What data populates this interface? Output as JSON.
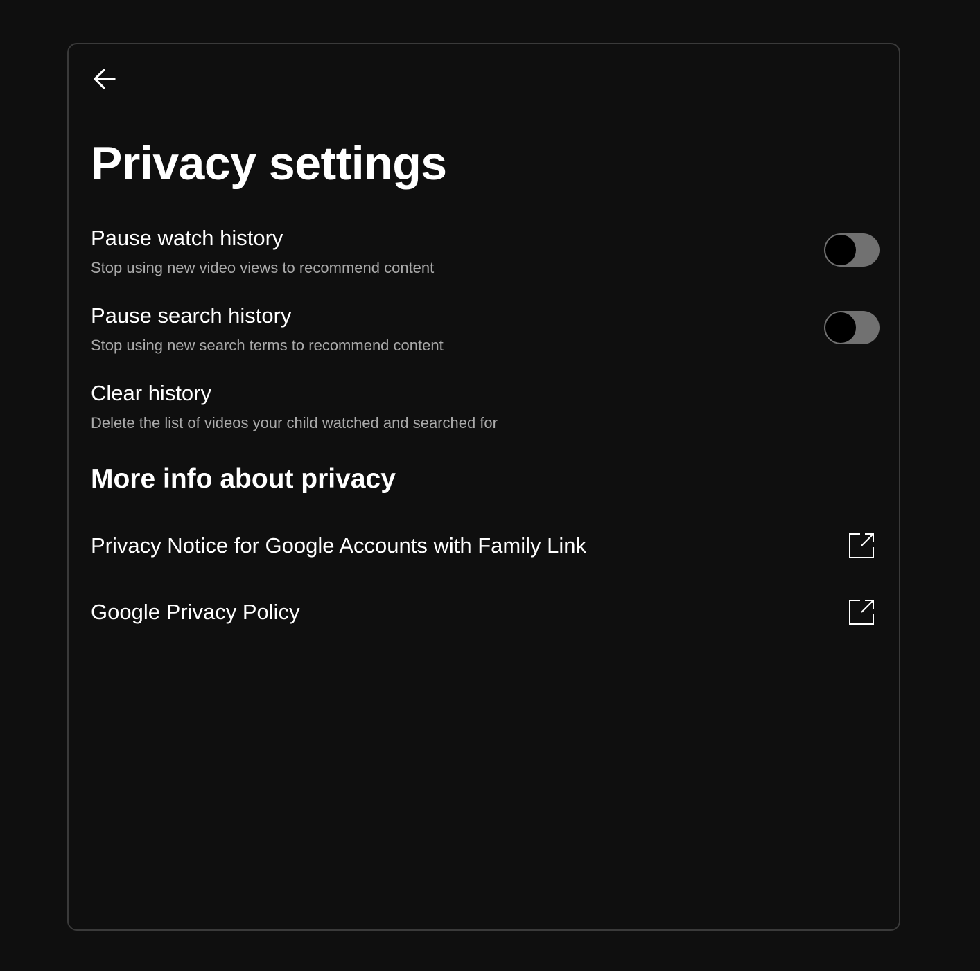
{
  "header": {
    "back_icon": "arrow-left-icon",
    "title": "Privacy settings"
  },
  "settings": [
    {
      "title": "Pause watch history",
      "description": "Stop using new video views to recommend content",
      "toggle_on": false
    },
    {
      "title": "Pause search history",
      "description": "Stop using new search terms to recommend content",
      "toggle_on": false
    },
    {
      "title": "Clear history",
      "description": "Delete the list of videos your child watched and searched for"
    }
  ],
  "more_info": {
    "title": "More info about privacy",
    "links": [
      {
        "label": "Privacy Notice for Google Accounts with Family Link",
        "icon": "external-link-icon"
      },
      {
        "label": "Google Privacy Policy",
        "icon": "external-link-icon"
      }
    ]
  },
  "colors": {
    "background": "#0f0f0f",
    "border": "#3a3a3a",
    "text_primary": "#ffffff",
    "text_secondary": "#aaaaaa",
    "toggle_track_off": "#717171",
    "toggle_knob_off": "#000000"
  }
}
